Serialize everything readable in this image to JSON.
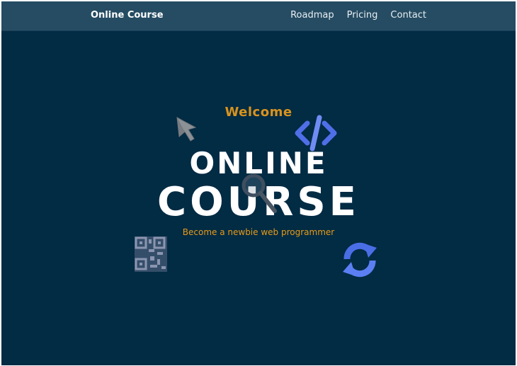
{
  "nav": {
    "brand": "Online Course",
    "links": [
      "Roadmap",
      "Pricing",
      "Contact"
    ]
  },
  "hero": {
    "welcome": "Welcome",
    "title_line1": "ONLINE",
    "title_line2": "COURSE",
    "subtitle": "Become a newbie web programmer"
  },
  "decorations": {
    "icons": [
      "cursor-arrow-icon",
      "code-brackets-icon",
      "magnifier-icon",
      "qr-code-icon",
      "refresh-icon"
    ]
  },
  "colors": {
    "background": "#022b44",
    "navbar": "#254c63",
    "accent_orange": "#d9931c",
    "icon_blue": "#5b7ff2"
  }
}
